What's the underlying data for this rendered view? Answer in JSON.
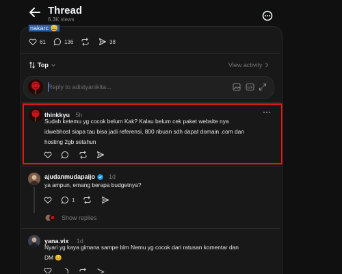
{
  "header": {
    "title": "Thread",
    "views": "6.3K views",
    "back_icon": "arrow-left-icon",
    "more_icon": "more-circle-icon"
  },
  "original_post": {
    "tail_text": "nakarc 😄",
    "stats": {
      "likes": "61",
      "comments": "136",
      "shares": "38"
    }
  },
  "sort_bar": {
    "sort_label": "Top",
    "activity_label": "View activity"
  },
  "reply_composer": {
    "placeholder": "Reply to adistyanikita..."
  },
  "comments": [
    {
      "username": "thinkkyu",
      "time": "5h",
      "text": "Sudah ketemu yg cocok belum Kak? Kalau belum cek paket website nya\nidwebhost siapa tau bisa jadi referensi, 800 ribuan sdh dapat domain .com dan\nhosting 2gb setahun",
      "highlighted": true
    },
    {
      "username": "ajudanmudapaijo",
      "verified": true,
      "time": "1d",
      "text": "ya ampun, emang berapa budgetnya?",
      "comment_count": "1",
      "show_replies": "Show replies"
    },
    {
      "username": "yana.vix",
      "time": "1d",
      "text": "Nyari yg kaya gimana sampe blm Nemu yg cocok dari ratusan komentar dan\nDM 😊"
    }
  ],
  "colors": {
    "background": "#101010",
    "panel": "#181818",
    "highlight_border": "#e11a1a",
    "verified": "#1d9bf0",
    "cursor": "#4a8cff"
  }
}
